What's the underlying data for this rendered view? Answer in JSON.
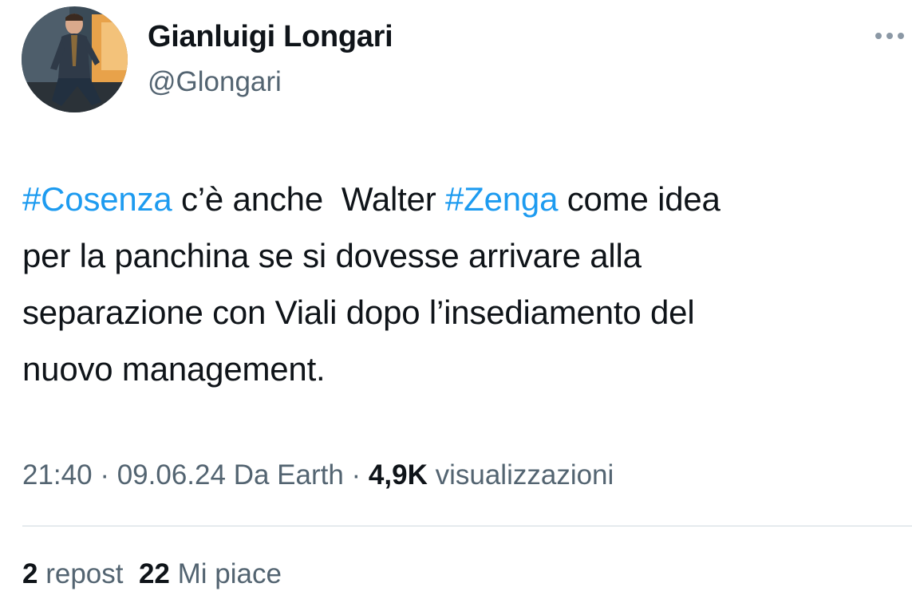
{
  "author": {
    "display_name": "Gianluigi Longari",
    "handle": "@Glongari"
  },
  "more_icon": "more-dots-icon",
  "tweet": {
    "hashtag_1": "#Cosenza",
    "text_1": " c’è anche  Walter ",
    "hashtag_2": "#Zenga",
    "text_2": " come idea\nper la panchina se si dovesse arrivare alla\nseparazione con Viali dopo l’insediamento del\nnuovo management."
  },
  "meta": {
    "time": "21:40",
    "date": "09.06.24",
    "source": "Da Earth",
    "separator": " · ",
    "views_count": "4,9K",
    "views_label": "visualizzazioni"
  },
  "stats": {
    "reposts_count": "2",
    "reposts_label": "repost",
    "likes_count": "22",
    "likes_label": "Mi piace"
  },
  "colors": {
    "link": "#1d9bf0",
    "secondary_text": "#536471",
    "primary_text": "#0f1419",
    "divider": "#cfd9de"
  }
}
